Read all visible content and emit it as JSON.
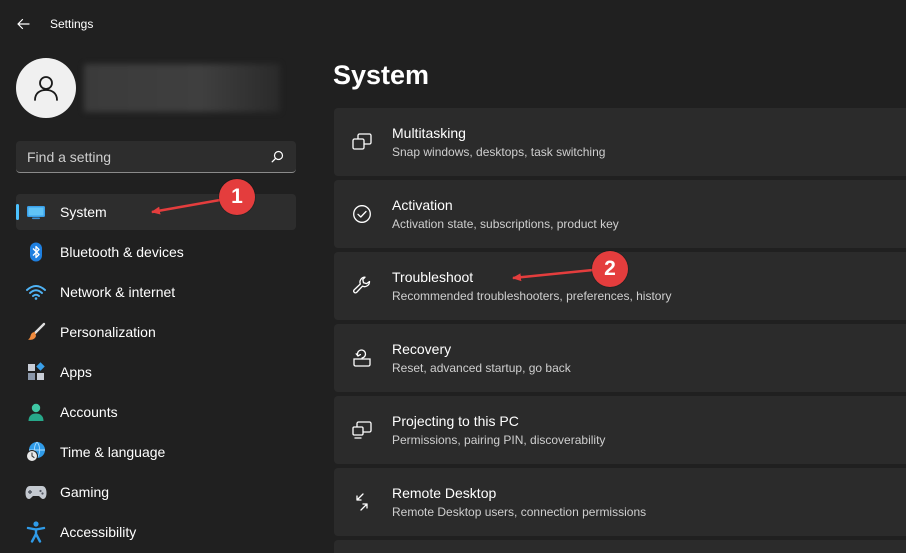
{
  "window": {
    "title": "Settings"
  },
  "search": {
    "placeholder": "Find a setting"
  },
  "sidebar": {
    "items": [
      {
        "label": "System",
        "icon": "monitor-icon"
      },
      {
        "label": "Bluetooth & devices",
        "icon": "bluetooth-icon"
      },
      {
        "label": "Network & internet",
        "icon": "wifi-icon"
      },
      {
        "label": "Personalization",
        "icon": "brush-icon"
      },
      {
        "label": "Apps",
        "icon": "apps-icon"
      },
      {
        "label": "Accounts",
        "icon": "person-icon"
      },
      {
        "label": "Time & language",
        "icon": "globe-clock-icon"
      },
      {
        "label": "Gaming",
        "icon": "gamepad-icon"
      },
      {
        "label": "Accessibility",
        "icon": "accessibility-icon"
      }
    ],
    "selected": "System"
  },
  "main": {
    "title": "System",
    "cards": [
      {
        "title": "Multitasking",
        "subtitle": "Snap windows, desktops, task switching",
        "icon": "multitasking-icon"
      },
      {
        "title": "Activation",
        "subtitle": "Activation state, subscriptions, product key",
        "icon": "check-circle-icon"
      },
      {
        "title": "Troubleshoot",
        "subtitle": "Recommended troubleshooters, preferences, history",
        "icon": "wrench-icon"
      },
      {
        "title": "Recovery",
        "subtitle": "Reset, advanced startup, go back",
        "icon": "recovery-icon"
      },
      {
        "title": "Projecting to this PC",
        "subtitle": "Permissions, pairing PIN, discoverability",
        "icon": "projecting-icon"
      },
      {
        "title": "Remote Desktop",
        "subtitle": "Remote Desktop users, connection permissions",
        "icon": "remote-desktop-icon"
      }
    ]
  },
  "annotations": [
    {
      "number": "1"
    },
    {
      "number": "2"
    }
  ],
  "colors": {
    "background": "#202020",
    "card": "#2b2b2b",
    "accent": "#4cc2ff",
    "annotation": "#e43d3d"
  }
}
